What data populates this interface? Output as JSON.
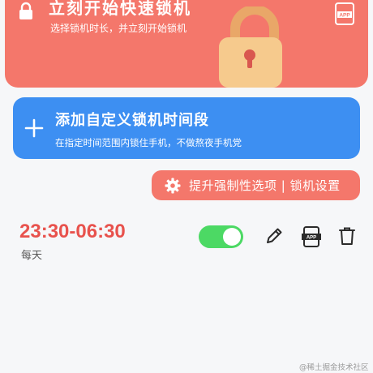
{
  "quick_lock": {
    "title": "立刻开始快速锁机",
    "subtitle": "选择锁机时长，并立刻开始锁机",
    "app_badge": "APP"
  },
  "custom_period": {
    "title": "添加自定义锁机时间段",
    "subtitle": "在指定时间范围内锁住手机，不做熬夜手机党"
  },
  "upgrade_button": {
    "label": "提升强制性选项 | 锁机设置"
  },
  "schedule": {
    "time_range": "23:30-06:30",
    "repeat": "每天",
    "enabled": true,
    "app_badge": "APP"
  },
  "watermark": "@稀土掘金技术社区",
  "colors": {
    "accent_red": "#f4776b",
    "accent_blue": "#3d8ff2",
    "time_red": "#e8524d",
    "toggle_green": "#4cd964"
  },
  "icons": [
    "lock-icon",
    "app-lock-icon",
    "padlock-illustration",
    "plus-icon",
    "gear-icon",
    "edit-icon",
    "app-lock-icon",
    "trash-icon"
  ]
}
